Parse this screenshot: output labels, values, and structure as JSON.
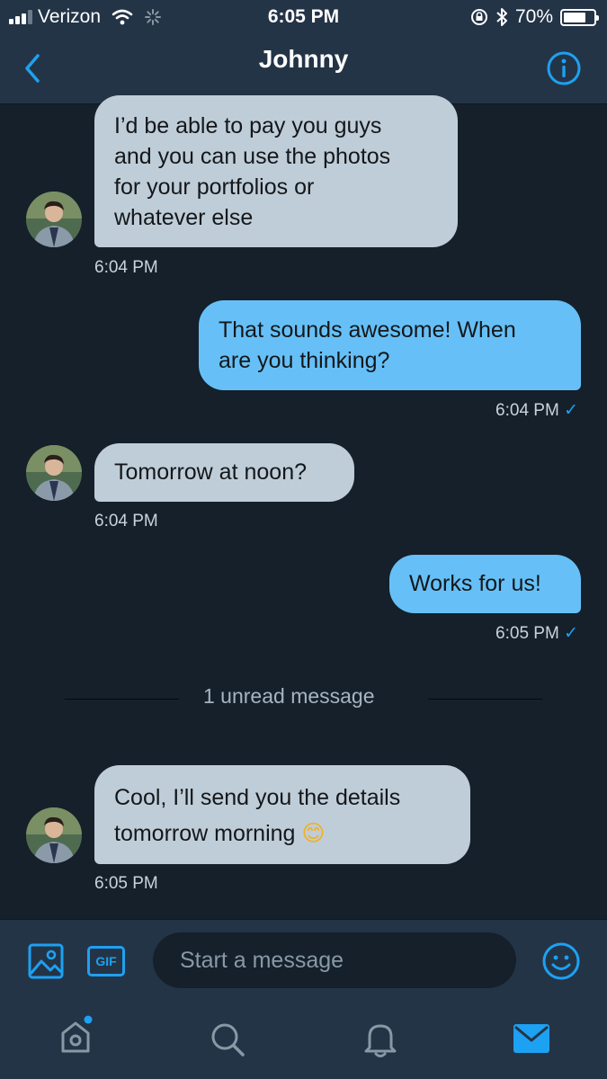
{
  "status_bar": {
    "carrier": "Verizon",
    "time": "6:05 PM",
    "battery": "70%",
    "battery_level": 0.7
  },
  "nav": {
    "title": "Johnny",
    "back_icon": "chevron-left-icon",
    "info_icon": "info-icon"
  },
  "messages": [
    {
      "direction": "incoming",
      "lines": [
        "I’d be able to pay you guys",
        "and you can use the photos",
        "for your portfolios or",
        "whatever else"
      ],
      "time": "6:04 PM"
    },
    {
      "direction": "outgoing",
      "lines": [
        "That sounds awesome! When",
        "are you thinking?"
      ],
      "time": "6:04 PM"
    },
    {
      "direction": "incoming",
      "lines": [
        "Tomorrow at noon?"
      ],
      "time": "6:04 PM"
    },
    {
      "direction": "outgoing",
      "lines": [
        "Works for us!"
      ],
      "time": "6:05 PM"
    },
    {
      "direction": "incoming",
      "lines": [
        "Cool, I’ll send you the details",
        "tomorrow morning"
      ],
      "emoji": "😊",
      "time": "6:05 PM"
    }
  ],
  "read_check": "✓",
  "unread_divider": "1 unread message",
  "composer": {
    "placeholder": "Start a message",
    "gif_label": "GIF"
  },
  "tabs": [
    {
      "name": "home-icon",
      "active": false,
      "has_dot": true
    },
    {
      "name": "search-icon",
      "active": false
    },
    {
      "name": "bell-icon",
      "active": false
    },
    {
      "name": "mail-icon",
      "active": true
    }
  ],
  "colors": {
    "background": "#15202b",
    "header": "#243447",
    "accent": "#1da1f2",
    "incoming_bubble": "#bfcdd8",
    "outgoing_bubble": "#66c0f7"
  }
}
